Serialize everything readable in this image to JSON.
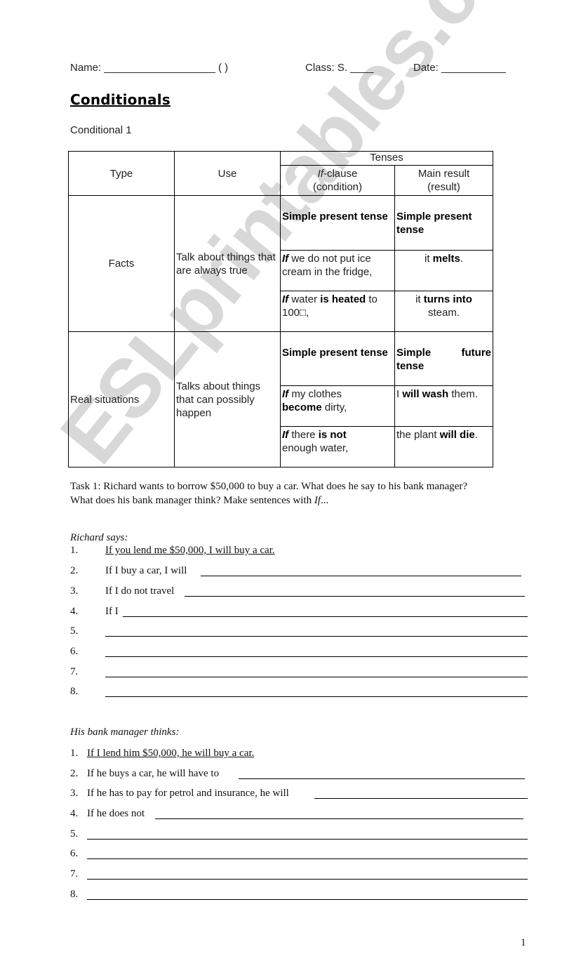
{
  "watermark": "ESLprintables.com",
  "header": {
    "name_label": "Name: ___________________ (      )",
    "class_label": "Class: S. ____",
    "date_label": "Date: ___________"
  },
  "title": "Conditionals",
  "subtitle": "Conditional 1",
  "table": {
    "headers": {
      "type": "Type",
      "use": "Use",
      "tenses": "Tenses",
      "if_clause_italic": "If",
      "if_clause_rest": "-clause",
      "if_clause_sub": "(condition)",
      "main_result": "Main result",
      "main_result_sub": "(result)"
    },
    "rows": [
      {
        "type": "Facts",
        "use": "Talk about things that are always true",
        "if_tense": "Simple present tense",
        "main_tense_a": "Simple present",
        "main_tense_b": "tense",
        "examples": [
          {
            "if_parts": [
              "If",
              " we do not put ice cream in the fridge,"
            ],
            "main_parts": [
              "it ",
              "melts",
              "."
            ]
          },
          {
            "if_parts": [
              "If",
              " water ",
              "is heated",
              " to 100□,"
            ],
            "main_parts": [
              "it ",
              "turns into",
              " steam."
            ]
          }
        ]
      },
      {
        "type": "Real situations",
        "use": "Talks about things that can possibly happen",
        "if_tense": "Simple present tense",
        "main_tense_a": "Simple",
        "main_tense_a2": "future",
        "main_tense_b": "tense",
        "examples": [
          {
            "if_parts": [
              "If",
              " my clothes ",
              "become",
              " dirty,"
            ],
            "main_parts": [
              "I ",
              "will wash",
              " them."
            ]
          },
          {
            "if_parts": [
              "If",
              " there ",
              "is not",
              " enough water,"
            ],
            "main_parts": [
              "the plant ",
              "will die",
              "."
            ]
          }
        ]
      }
    ]
  },
  "task": {
    "line1": "Task 1: Richard wants to borrow $50,000 to buy a car.  What does he say to his bank manager?",
    "line2_prefix": "What does his bank manager think?   Make sentences with ",
    "line2_italic": "If",
    "line2_suffix": "..."
  },
  "richard": {
    "label": "Richard says:",
    "items": [
      {
        "num": "1.",
        "text": "If you lend me $50,000, I will buy a car."
      },
      {
        "num": "2.",
        "text": "If I buy a car, I will"
      },
      {
        "num": "3.",
        "text": "If I do not travel"
      },
      {
        "num": "4.",
        "text": "If I"
      },
      {
        "num": "5.",
        "text": ""
      },
      {
        "num": "6.",
        "text": ""
      },
      {
        "num": "7.",
        "text": ""
      },
      {
        "num": "8.",
        "text": ""
      }
    ]
  },
  "manager": {
    "label": "His bank manager thinks:",
    "items": [
      {
        "num": "1.",
        "text": "If I lend him $50,000, he will buy a car."
      },
      {
        "num": "2.",
        "text": "If he buys a car, he will have to"
      },
      {
        "num": "3.",
        "text": "If he has to pay for petrol and insurance, he will"
      },
      {
        "num": "4.",
        "text": "If he does not"
      },
      {
        "num": "5.",
        "text": ""
      },
      {
        "num": "6.",
        "text": ""
      },
      {
        "num": "7.",
        "text": ""
      },
      {
        "num": "8.",
        "text": ""
      }
    ]
  },
  "page_number": "1"
}
